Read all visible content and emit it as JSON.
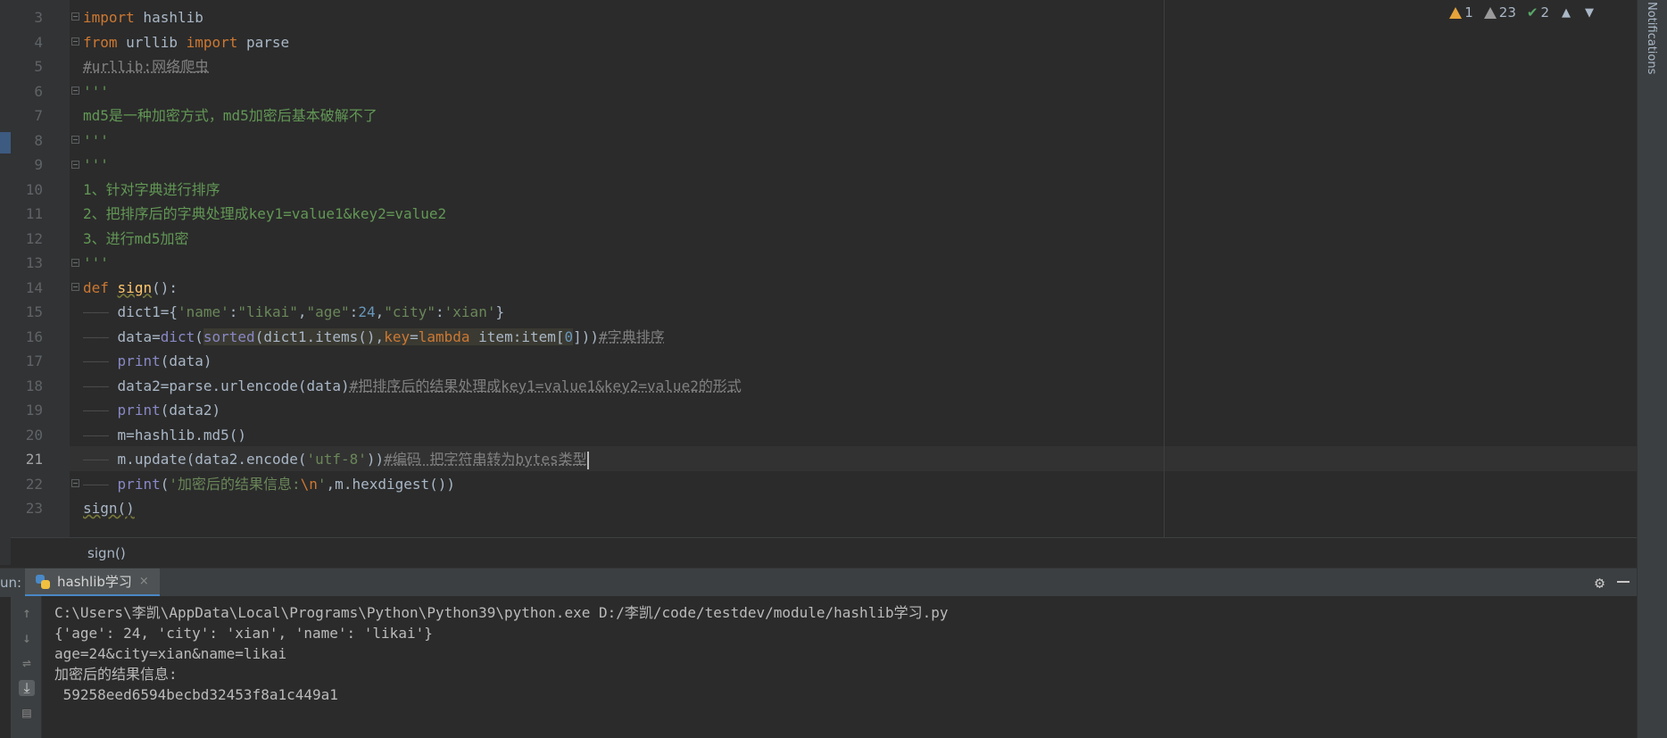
{
  "editor": {
    "line_numbers": [
      "3",
      "4",
      "5",
      "6",
      "7",
      "8",
      "9",
      "10",
      "11",
      "12",
      "13",
      "14",
      "15",
      "16",
      "17",
      "18",
      "19",
      "20",
      "21",
      "22",
      "23"
    ],
    "current_line": "21",
    "lines": {
      "l3_kw": "import",
      "l3_rest": " hashlib",
      "l4_kw1": "from",
      "l4_mod": " urllib ",
      "l4_kw2": "import",
      "l4_rest": " parse",
      "l5_comment": "#urllib:网络爬虫",
      "l6_doc": "'''",
      "l7_doc": "md5是一种加密方式，md5加密后基本破解不了",
      "l8_doc": "'''",
      "l9_doc": "'''",
      "l10_doc": "1、针对字典进行排序",
      "l11_doc": "2、把排序后的字典处理成key1=value1&key2=value2",
      "l12_doc": "3、进行md5加密",
      "l13_doc": "'''",
      "l14_kw": "def",
      "l14_fn": "sign",
      "l14_rest": "():",
      "l15_a": "dict1={",
      "l15_s1": "'name'",
      "l15_c1": ":",
      "l15_s2": "\"likai\"",
      "l15_c2": ",",
      "l15_s3": "\"age\"",
      "l15_c3": ":",
      "l15_n": "24",
      "l15_c4": ",",
      "l15_s4": "\"city\"",
      "l15_c5": ":",
      "l15_s5": "'xian'",
      "l15_end": "}",
      "l16_a": "data=",
      "l16_bi1": "dict",
      "l16_p": "(",
      "l16_bi2": "sorted",
      "l16_b": "(dict1.items(),",
      "l16_kw1": "key",
      "l16_eq": "=",
      "l16_kw2": "lambda",
      "l16_c": " item:item[",
      "l16_n": "0",
      "l16_d": "]))",
      "l16_cm": "#字典排序",
      "l17_bi": "print",
      "l17_rest": "(data)",
      "l18_a": "data2=parse.urlencode(data)",
      "l18_cm": "#把排序后的结果处理成key1=value1&key2=value2的形式",
      "l19_bi": "print",
      "l19_rest": "(data2)",
      "l20": "m=hashlib.md5()",
      "l21_a": "m.update(data2.encode(",
      "l21_s": "'utf-8'",
      "l21_b": "))",
      "l21_cm": "#编码 把字符串转为bytes类型",
      "l22_bi": "print",
      "l22_p": "(",
      "l22_s": "'加密后的结果信息:",
      "l22_esc": "\\n",
      "l22_s2": "'",
      "l22_rest": ",m.hexdigest())",
      "l23": "sign()"
    },
    "inspection": {
      "errors": "1",
      "warnings": "23",
      "ok": "2",
      "up_icon": "▲",
      "down_icon": "▼"
    }
  },
  "right_panel": {
    "notifications_label": "Notifications"
  },
  "breadcrumb": {
    "text": "sign()"
  },
  "run_window": {
    "label": "un:",
    "tab_label": "hashlib学习",
    "close_glyph": "×",
    "settings_icon": "⚙",
    "output": [
      "C:\\Users\\李凯\\AppData\\Local\\Programs\\Python\\Python39\\python.exe D:/李凯/code/testdev/module/hashlib学习.py",
      "{'age': 24, 'city': 'xian', 'name': 'likai'}",
      "age=24&city=xian&name=likai",
      "加密后的结果信息:",
      " 59258eed6594becbd32453f8a1c449a1"
    ]
  },
  "colors": {
    "keyword": "#cc7832",
    "string": "#6a8759",
    "number": "#6897bb",
    "function": "#ffc66d",
    "builtin": "#8888c6",
    "comment": "#808080",
    "background": "#2b2b2b"
  }
}
